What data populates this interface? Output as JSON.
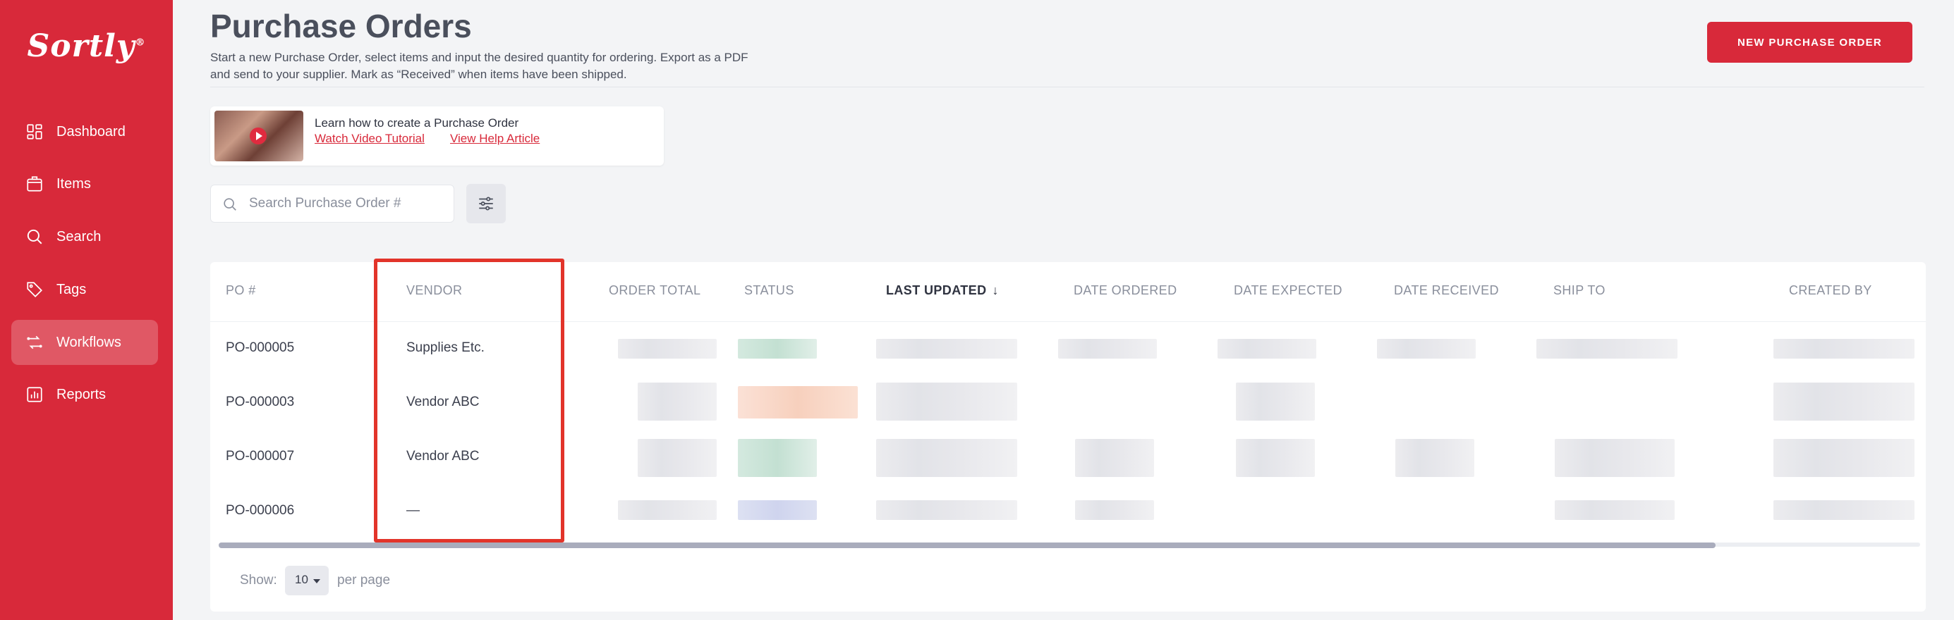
{
  "app": {
    "logo": "Sortly",
    "logo_mark": "®"
  },
  "sidebar": {
    "items": [
      {
        "label": "Dashboard",
        "icon": "dashboard-icon"
      },
      {
        "label": "Items",
        "icon": "items-icon"
      },
      {
        "label": "Search",
        "icon": "search-icon"
      },
      {
        "label": "Tags",
        "icon": "tag-icon"
      },
      {
        "label": "Workflows",
        "icon": "workflows-icon",
        "active": true
      },
      {
        "label": "Reports",
        "icon": "reports-icon"
      }
    ]
  },
  "header": {
    "title": "Purchase Orders",
    "description_line1": "Start a new Purchase Order, select items and input the desired quantity for ordering. Export as a PDF",
    "description_line2": "and send to your supplier. Mark as “Received” when items have been shipped.",
    "new_button": "NEW PURCHASE ORDER"
  },
  "tutorial": {
    "title": "Learn how to create a Purchase Order",
    "video_link": "Watch Video Tutorial",
    "help_link": "View Help Article"
  },
  "search": {
    "placeholder": "Search Purchase Order #"
  },
  "table": {
    "columns": [
      "PO #",
      "VENDOR",
      "ORDER TOTAL",
      "STATUS",
      "LAST UPDATED",
      "DATE ORDERED",
      "DATE EXPECTED",
      "DATE RECEIVED",
      "SHIP TO",
      "CREATED BY"
    ],
    "sorted_column": "LAST UPDATED",
    "sort_arrow": "↓",
    "rows": [
      {
        "po": "PO-000005",
        "vendor": "Supplies Etc."
      },
      {
        "po": "PO-000003",
        "vendor": "Vendor ABC"
      },
      {
        "po": "PO-000007",
        "vendor": "Vendor ABC"
      },
      {
        "po": "PO-000006",
        "vendor": "—"
      }
    ]
  },
  "pagination": {
    "show_label": "Show:",
    "per_page_value": "10",
    "per_page_label": "per page"
  },
  "colors": {
    "brand": "#d8293a",
    "highlight": "#e2342a"
  }
}
